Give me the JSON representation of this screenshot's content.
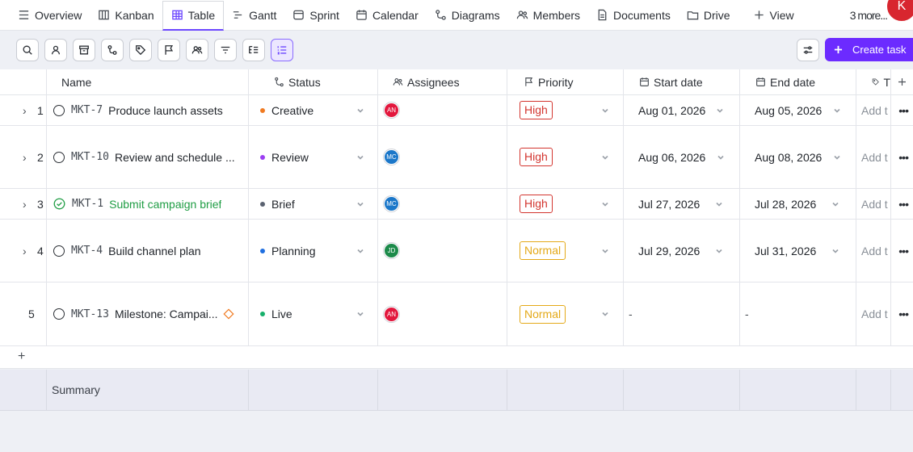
{
  "tabs": [
    {
      "label": "Overview",
      "icon": "list-icon"
    },
    {
      "label": "Kanban",
      "icon": "kanban-icon"
    },
    {
      "label": "Table",
      "icon": "table-icon",
      "active": true
    },
    {
      "label": "Gantt",
      "icon": "gantt-icon"
    },
    {
      "label": "Sprint",
      "icon": "sprint-icon"
    },
    {
      "label": "Calendar",
      "icon": "calendar-icon"
    },
    {
      "label": "Diagrams",
      "icon": "diagram-icon"
    },
    {
      "label": "Members",
      "icon": "members-icon"
    },
    {
      "label": "Documents",
      "icon": "document-icon"
    },
    {
      "label": "Drive",
      "icon": "folder-icon"
    }
  ],
  "more_tabs": "3 more...",
  "add_view": "View",
  "user_initial": "K",
  "create_task": "Create task",
  "columns": {
    "name": "Name",
    "status": "Status",
    "assignees": "Assignees",
    "priority": "Priority",
    "start": "Start date",
    "end": "End date",
    "tags": "T"
  },
  "rows": [
    {
      "num": "1",
      "id": "MKT-7",
      "name": "Produce launch assets",
      "done": false,
      "milestone": false,
      "status": "Creative",
      "status_color": "#f07a21",
      "assignee": "AN",
      "assignee_color": "#e2173d",
      "priority": "High",
      "start": "Aug 01, 2026",
      "end": "Aug 05, 2026",
      "tags": "Add t"
    },
    {
      "num": "2",
      "id": "MKT-10",
      "name": "Review and schedule ...",
      "done": false,
      "milestone": false,
      "status": "Review",
      "status_color": "#9b3ef2",
      "assignee": "MC",
      "assignee_color": "#1b77c9",
      "priority": "High",
      "start": "Aug 06, 2026",
      "end": "Aug 08, 2026",
      "tags": "Add t"
    },
    {
      "num": "3",
      "id": "MKT-1",
      "name": "Submit campaign brief",
      "done": true,
      "milestone": false,
      "status": "Brief",
      "status_color": "#5a6270",
      "assignee": "MC",
      "assignee_color": "#1b77c9",
      "priority": "High",
      "start": "Jul 27, 2026",
      "end": "Jul 28, 2026",
      "tags": "Add t"
    },
    {
      "num": "4",
      "id": "MKT-4",
      "name": "Build channel plan",
      "done": false,
      "milestone": false,
      "status": "Planning",
      "status_color": "#1f6fe0",
      "assignee": "JD",
      "assignee_color": "#1c8a4a",
      "priority": "Normal",
      "start": "Jul 29, 2026",
      "end": "Jul 31, 2026",
      "tags": "Add t"
    },
    {
      "num": "5",
      "id": "MKT-13",
      "name": "Milestone: Campai...",
      "done": false,
      "milestone": true,
      "status": "Live",
      "status_color": "#17b06b",
      "assignee": "AN",
      "assignee_color": "#e2173d",
      "priority": "Normal",
      "start": "-",
      "end": "-",
      "tags": "Add t"
    }
  ],
  "summary_label": "Summary",
  "colors": {
    "accent": "#6c2bff",
    "high": "#d3352f",
    "normal": "#e4a918",
    "done": "#1f9d44"
  }
}
